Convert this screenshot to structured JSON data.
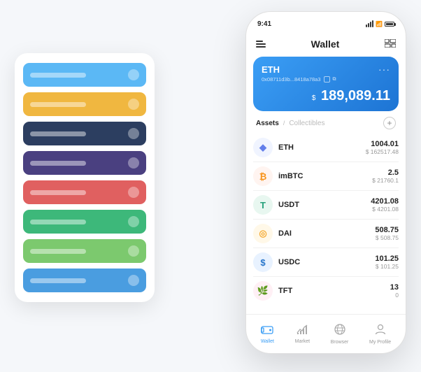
{
  "scene": {
    "background": "#f5f7fa"
  },
  "cardStack": {
    "items": [
      {
        "color": "#5bb8f5",
        "iconColor": "rgba(255,255,255,0.35)"
      },
      {
        "color": "#f0b740",
        "iconColor": "rgba(255,255,255,0.35)"
      },
      {
        "color": "#2c3e60",
        "iconColor": "rgba(255,255,255,0.35)"
      },
      {
        "color": "#4a4080",
        "iconColor": "rgba(255,255,255,0.35)"
      },
      {
        "color": "#e06060",
        "iconColor": "rgba(255,255,255,0.35)"
      },
      {
        "color": "#3db87a",
        "iconColor": "rgba(255,255,255,0.35)"
      },
      {
        "color": "#7cc96e",
        "iconColor": "rgba(255,255,255,0.35)"
      },
      {
        "color": "#4a9de0",
        "iconColor": "rgba(255,255,255,0.35)"
      }
    ]
  },
  "phone": {
    "statusBar": {
      "time": "9:41"
    },
    "header": {
      "title": "Wallet"
    },
    "ethCard": {
      "label": "ETH",
      "address": "0x08711d3b...8418a78a3",
      "balanceCurrency": "$",
      "balance": "189,089.11"
    },
    "assetsSection": {
      "activeTab": "Assets",
      "separator": "/",
      "inactiveTab": "Collectibles"
    },
    "assets": [
      {
        "symbol": "ETH",
        "icon": "♦",
        "iconBg": "#f0f4ff",
        "amount": "1004.01",
        "usd": "$ 162517.48"
      },
      {
        "symbol": "imBTC",
        "icon": "⊕",
        "iconBg": "#fff4f0",
        "amount": "2.5",
        "usd": "$ 21760.1"
      },
      {
        "symbol": "USDT",
        "icon": "T",
        "iconBg": "#e8f7f0",
        "amount": "4201.08",
        "usd": "$ 4201.08"
      },
      {
        "symbol": "DAI",
        "icon": "◎",
        "iconBg": "#fff8e8",
        "amount": "508.75",
        "usd": "$ 508.75"
      },
      {
        "symbol": "USDC",
        "icon": "⊙",
        "iconBg": "#e8f2ff",
        "amount": "101.25",
        "usd": "$ 101.25"
      },
      {
        "symbol": "TFT",
        "icon": "🌿",
        "iconBg": "#fff0f5",
        "amount": "13",
        "usd": "0"
      }
    ],
    "nav": [
      {
        "icon": "◉",
        "label": "Wallet",
        "active": true
      },
      {
        "icon": "📈",
        "label": "Market",
        "active": false
      },
      {
        "icon": "🌐",
        "label": "Browser",
        "active": false
      },
      {
        "icon": "👤",
        "label": "My Profile",
        "active": false
      }
    ]
  }
}
